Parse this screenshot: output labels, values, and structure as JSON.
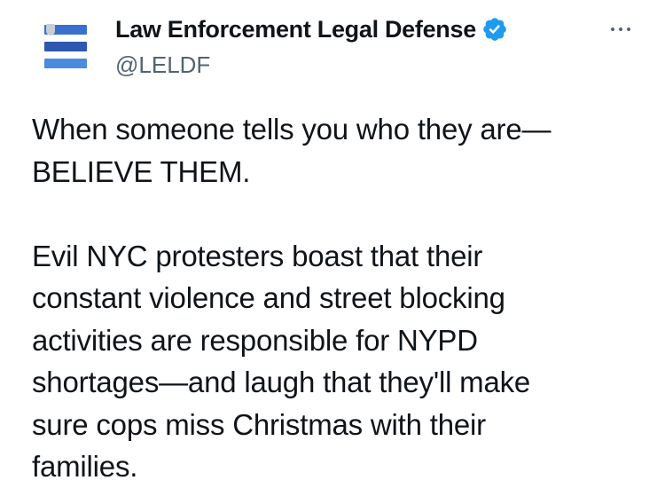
{
  "tweet": {
    "author": {
      "display_name": "Law Enforcement Legal Defense",
      "handle": "@LELDF",
      "verified": true,
      "avatar_icon": "blue-stripes-logo-icon",
      "verified_icon": "verified-badge-icon",
      "verified_color": "#1d9bf0"
    },
    "more_icon": "more-horizontal-icon",
    "paragraphs": [
      "When someone tells you who they are—\nBELIEVE THEM.",
      "Evil NYC protesters boast that their\nconstant violence and street blocking\nactivities are responsible for NYPD\nshortages—and laugh that they'll make\nsure cops miss Christmas with their\nfamilies."
    ]
  },
  "colors": {
    "text_primary": "#0f1419",
    "text_secondary": "#536471",
    "background": "#ffffff"
  }
}
